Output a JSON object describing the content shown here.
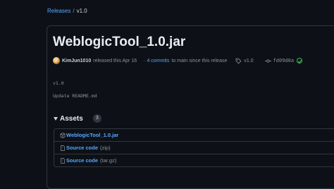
{
  "breadcrumb": {
    "parent": "Releases",
    "separator": "/",
    "current": "v1.0"
  },
  "release": {
    "title": "WeblogicTool_1.0.jar",
    "author": "KimJun1010",
    "released_text": "released this Apr 16",
    "commits_link": "4 commits",
    "since_text": "to main since this release",
    "tag": "v1.0",
    "commit_hash": "fd09d0a",
    "body_line_1": "v1.0",
    "body_line_2": "Update README.md"
  },
  "assets": {
    "heading": "Assets",
    "count": "3",
    "items": [
      {
        "name": "WeblogicTool_1.0.jar",
        "suffix": "",
        "icon": "package-icon"
      },
      {
        "name": "Source code",
        "suffix": "(zip)",
        "icon": "file-zip-icon"
      },
      {
        "name": "Source code",
        "suffix": "(tar.gz)",
        "icon": "file-zip-icon"
      }
    ]
  },
  "colors": {
    "background": "#0d1117",
    "border": "#30363d",
    "link": "#58a6ff",
    "muted": "#8b949e",
    "verified": "#3fb950"
  }
}
